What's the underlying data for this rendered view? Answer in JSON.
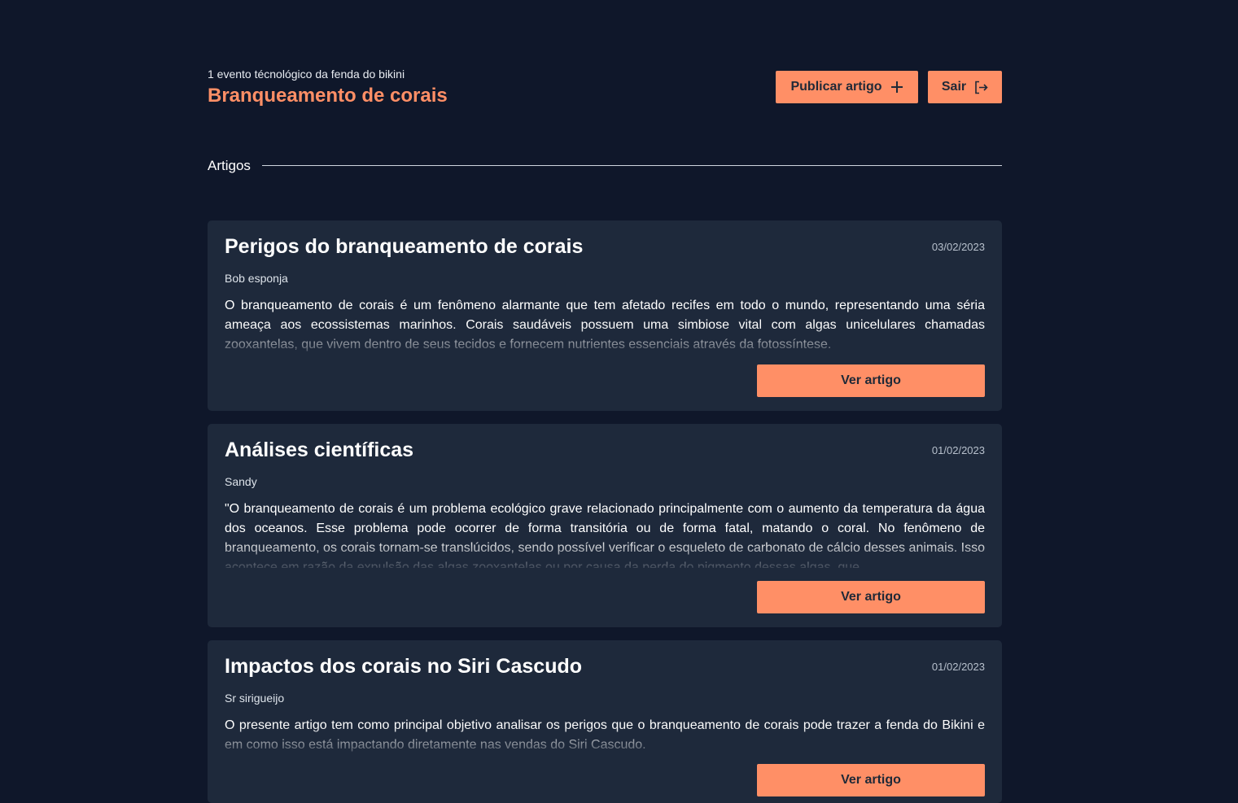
{
  "header": {
    "subtitle": "1 evento técnológico da fenda do bikini",
    "title": "Branqueamento de corais",
    "publish_label": "Publicar artigo",
    "publish_icon": "plus-icon",
    "exit_label": "Sair",
    "exit_icon": "logout-icon"
  },
  "section": {
    "title": "Artigos"
  },
  "articles": [
    {
      "title": "Perigos do branqueamento de corais",
      "date": "03/02/2023",
      "author": "Bob esponja",
      "excerpt": "O branqueamento de corais é um fenômeno alarmante que tem afetado recifes em todo o mundo, representando uma séria ameaça aos ecossistemas marinhos. Corais saudáveis possuem uma simbiose vital com algas unicelulares chamadas zooxantelas, que vivem dentro de seus tecidos e fornecem nutrientes essenciais através da fotossíntese.",
      "button_label": "Ver artigo"
    },
    {
      "title": "Análises científicas",
      "date": "01/02/2023",
      "author": "Sandy",
      "excerpt": "\"O branqueamento de corais é um problema ecológico grave relacionado principalmente com o aumento da temperatura da água dos oceanos. Esse problema pode ocorrer de forma transitória ou de forma fatal, matando o coral. No fenômeno de branqueamento, os corais tornam-se translúcidos, sendo possível verificar o esqueleto de carbonato de cálcio desses animais. Isso acontece em razão da expulsão das algas zooxantelas ou por causa da perda do pigmento dessas algas, que",
      "button_label": "Ver artigo"
    },
    {
      "title": "Impactos dos corais no Siri Cascudo",
      "date": "01/02/2023",
      "author": "Sr sirigueijo",
      "excerpt": "O presente artigo tem como principal objetivo analisar os perigos que o branqueamento de corais pode trazer a fenda do Bikini e em como isso está impactando diretamente nas vendas do Siri Cascudo.",
      "button_label": "Ver artigo"
    }
  ],
  "colors": {
    "background": "#0f172a",
    "card": "#1e293b",
    "accent": "#ff8f66"
  }
}
